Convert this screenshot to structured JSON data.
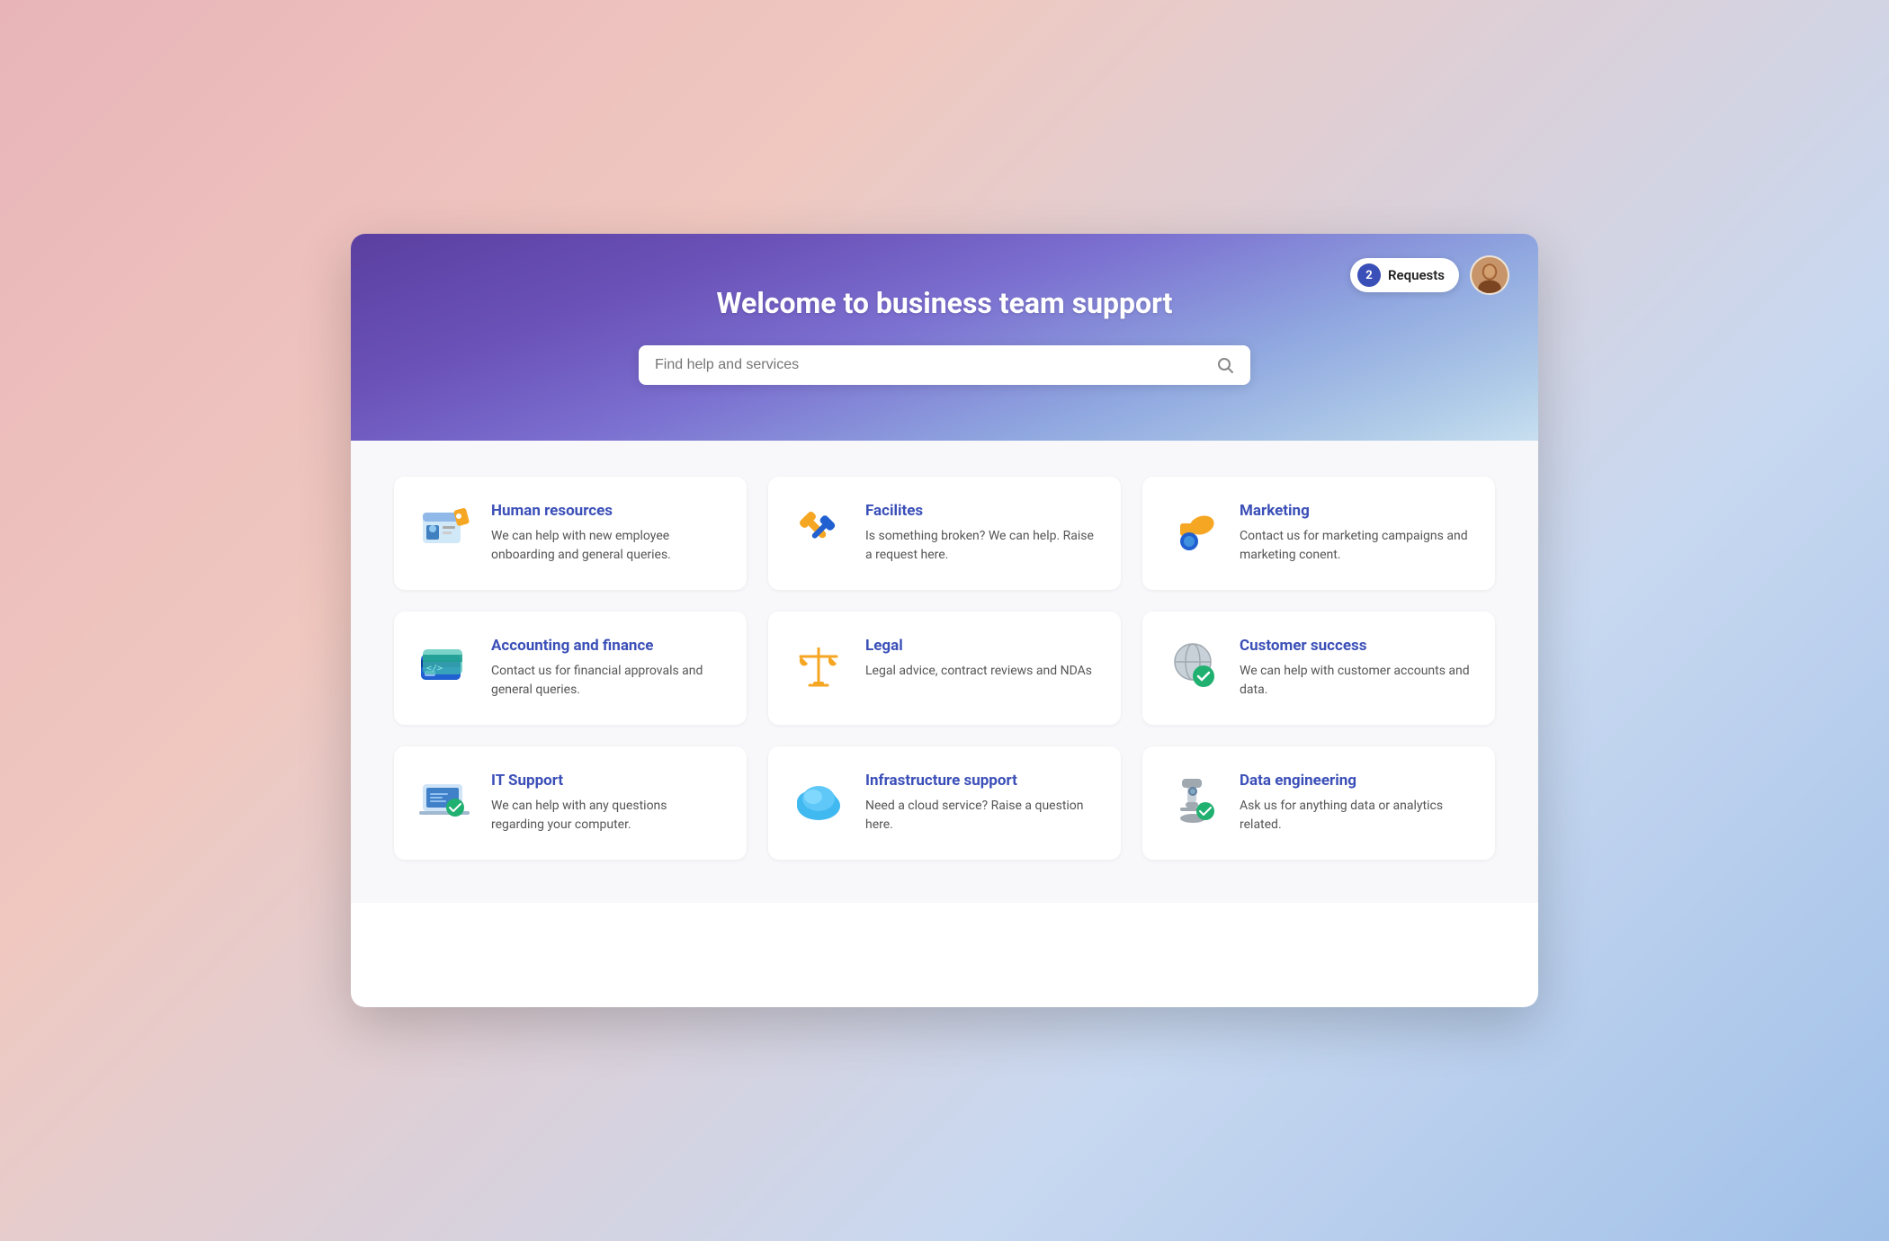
{
  "hero": {
    "title": "Welcome to business team support",
    "search_placeholder": "Find help and services",
    "requests_count": "2",
    "requests_label": "Requests"
  },
  "cards": [
    {
      "id": "human-resources",
      "title": "Human resources",
      "description": "We can help with new employee onboarding and general queries.",
      "icon": "hr"
    },
    {
      "id": "facilities",
      "title": "Facilites",
      "description": "Is something broken? We can help. Raise a request here.",
      "icon": "facilities"
    },
    {
      "id": "marketing",
      "title": "Marketing",
      "description": "Contact us for marketing campaigns and marketing conent.",
      "icon": "marketing"
    },
    {
      "id": "accounting-finance",
      "title": "Accounting and finance",
      "description": "Contact us for financial approvals and general queries.",
      "icon": "accounting"
    },
    {
      "id": "legal",
      "title": "Legal",
      "description": "Legal advice, contract reviews and NDAs",
      "icon": "legal"
    },
    {
      "id": "customer-success",
      "title": "Customer success",
      "description": "We can help with customer accounts and data.",
      "icon": "customer-success"
    },
    {
      "id": "it-support",
      "title": "IT Support",
      "description": "We can help with any questions regarding your computer.",
      "icon": "it"
    },
    {
      "id": "infrastructure-support",
      "title": "Infrastructure support",
      "description": "Need a cloud service? Raise a question here.",
      "icon": "infrastructure"
    },
    {
      "id": "data-engineering",
      "title": "Data engineering",
      "description": "Ask us for anything data or analytics related.",
      "icon": "data"
    }
  ]
}
